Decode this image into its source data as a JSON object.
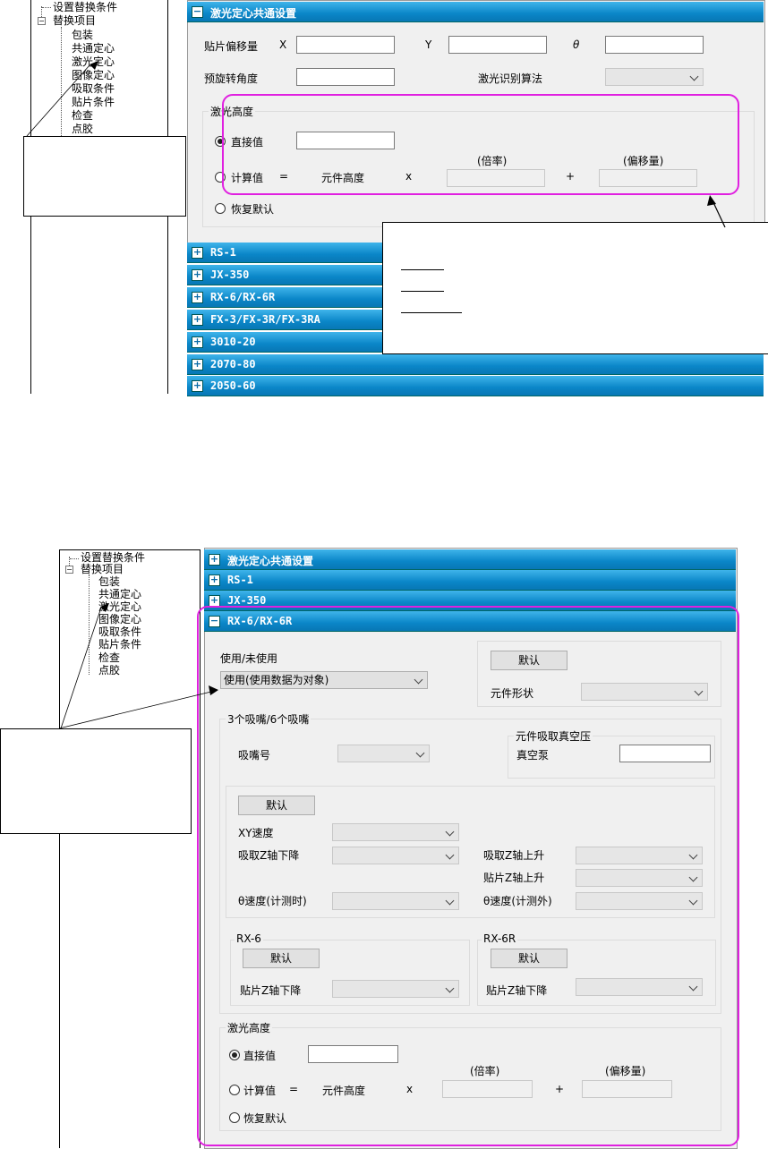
{
  "tree": {
    "items": [
      "设置替换条件",
      "替换项目",
      "包装",
      "共通定心",
      "激光定心",
      "图像定心",
      "吸取条件",
      "贴片条件",
      "检查",
      "点胶"
    ],
    "minus_symbol": "−"
  },
  "top": {
    "sections": [
      "激光定心共通设置",
      "RS-1",
      "JX-350",
      "RX-6/RX-6R",
      "FX-3/FX-3R/FX-3RA",
      "3010-20",
      "2070-80",
      "2050-60"
    ],
    "expanded_symbol": "−",
    "collapsed_symbol": "+",
    "offset_label": "贴片偏移量",
    "x_label": "X",
    "y_label": "Y",
    "theta_label": "θ",
    "pre_rotation_label": "预旋转角度",
    "algorithm_label": "激光识别算法",
    "laser_height": {
      "title": "激光高度",
      "direct": "直接值",
      "calc": "计算值",
      "equals": "=",
      "component_height": "元件高度",
      "times": "x",
      "ratio": "(倍率)",
      "plus": "+",
      "offset": "(偏移量)",
      "restore": "恢复默认"
    }
  },
  "bottom": {
    "sections": [
      "激光定心共通设置",
      "RS-1",
      "JX-350",
      "RX-6/RX-6R"
    ],
    "use_label": "使用/未使用",
    "use_value": "使用(使用数据为对象)",
    "default": "默认",
    "shape_label": "元件形状",
    "nozzle_group": "3个吸嘴/6个吸嘴",
    "nozzle_no": "吸嘴号",
    "vacuum_group": "元件吸取真空压",
    "vacuum_pump": "真空泵",
    "xy_speed": "XY速度",
    "pick_z_down": "吸取Z轴下降",
    "pick_z_up": "吸取Z轴上升",
    "place_z_up": "贴片Z轴上升",
    "theta_meas": "θ速度(计测时)",
    "theta_nonmeas": "θ速度(计测外)",
    "rx6": "RX-6",
    "rx6r": "RX-6R",
    "place_z_down": "贴片Z轴下降"
  },
  "colors": {
    "header_blue": "#0a86c8",
    "highlight": "#e020e0"
  }
}
